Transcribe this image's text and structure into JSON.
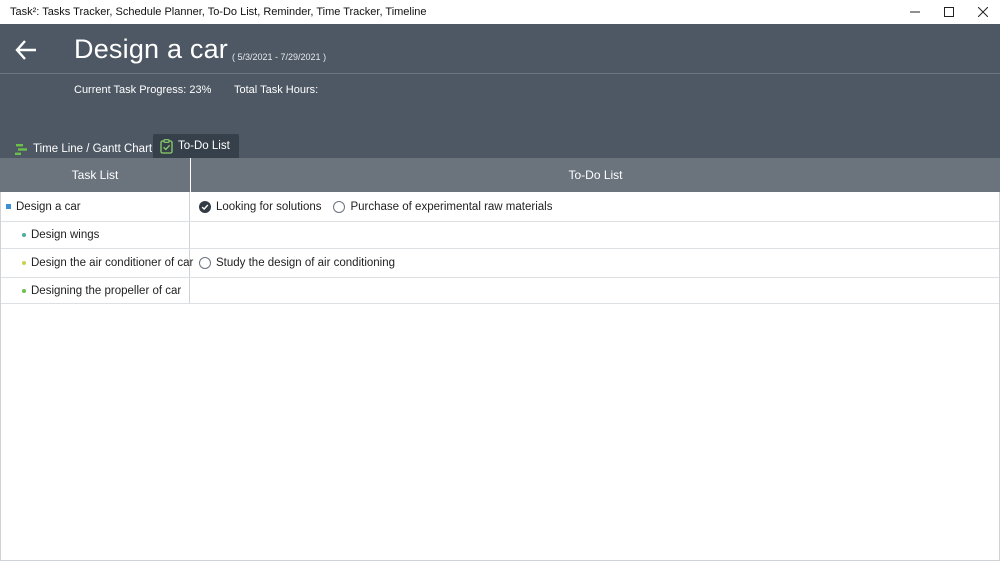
{
  "window": {
    "title": "Task²: Tasks Tracker, Schedule Planner, To-Do List, Reminder, Time Tracker, Timeline"
  },
  "header": {
    "title": "Design a car",
    "date_range": "( 5/3/2021 - 7/29/2021 )",
    "progress": "Current Task Progress: 23%",
    "hours": "Total Task Hours:"
  },
  "tabs": [
    {
      "label": "Time Line / Gantt Chart",
      "active": false,
      "icon": "gantt-icon"
    },
    {
      "label": "To-Do List",
      "active": true,
      "icon": "clipboard-check-icon"
    }
  ],
  "table": {
    "headers": [
      "Task List",
      "To-Do List"
    ],
    "rows": [
      {
        "task": "Design a car",
        "level": 0,
        "todos": [
          {
            "label": "Looking for solutions",
            "done": true
          },
          {
            "label": "Purchase of experimental raw materials",
            "done": false
          }
        ]
      },
      {
        "task": "Design wings",
        "level": 1,
        "todos": []
      },
      {
        "task": "Design the air conditioner of car",
        "level": 1,
        "todos": [
          {
            "label": "Study the design of air conditioning",
            "done": false
          }
        ]
      },
      {
        "task": "Designing the propeller of car",
        "level": 1,
        "todos": []
      }
    ]
  },
  "colors": {
    "header_bg": "#4e5864",
    "table_header_bg": "#6b737d",
    "active_tab_bg": "#36404a",
    "bullet_parent": "#3a8fd9",
    "bullet_child": [
      "#4cae9f",
      "#4cae9f",
      "#c7d24c",
      "#6cc04a"
    ],
    "gantt_icon": "#6cc04a"
  }
}
